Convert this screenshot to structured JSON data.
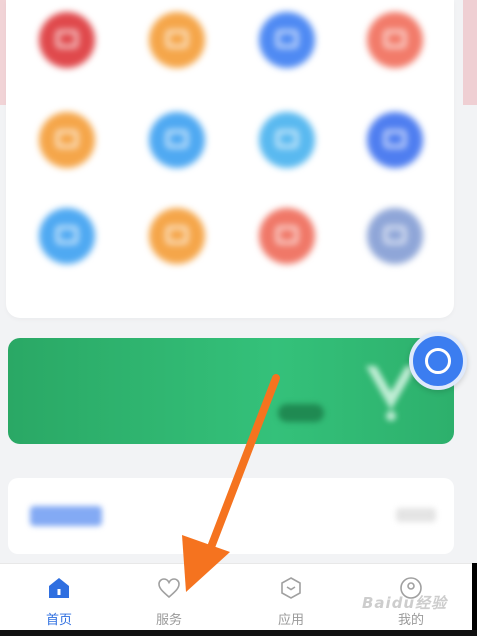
{
  "service_grid": [
    {
      "label": "",
      "color": "#e0494c"
    },
    {
      "label": "",
      "color": "#f5a64a"
    },
    {
      "label": "",
      "color": "#4f8af3"
    },
    {
      "label": "",
      "color": "#f27b6a"
    },
    {
      "label": "",
      "color": "#f5a64a"
    },
    {
      "label": "",
      "color": "#4fa9f2"
    },
    {
      "label": "",
      "color": "#59b9f0"
    },
    {
      "label": "",
      "color": "#4f7ef0"
    },
    {
      "label": "",
      "color": "#4fa9f2"
    },
    {
      "label": "",
      "color": "#f5a64a"
    },
    {
      "label": "",
      "color": "#f07868"
    },
    {
      "label": "",
      "color": "#8fa6d8"
    }
  ],
  "banner": {
    "title": "",
    "subtitle": "",
    "color": "#2aa865"
  },
  "notice": {
    "text": ""
  },
  "tabbar": {
    "tabs": [
      {
        "label": "首页",
        "icon": "home-icon",
        "active": true
      },
      {
        "label": "服务",
        "icon": "heart-icon",
        "active": false
      },
      {
        "label": "应用",
        "icon": "box-icon",
        "active": false
      },
      {
        "label": "我的",
        "icon": "user-icon",
        "active": false
      }
    ],
    "active_color": "#2f6fe0",
    "inactive_color": "#9a9a9a"
  },
  "watermark": {
    "text": "Baidu经验"
  },
  "annotation": {
    "arrow_color": "#f5731f"
  }
}
